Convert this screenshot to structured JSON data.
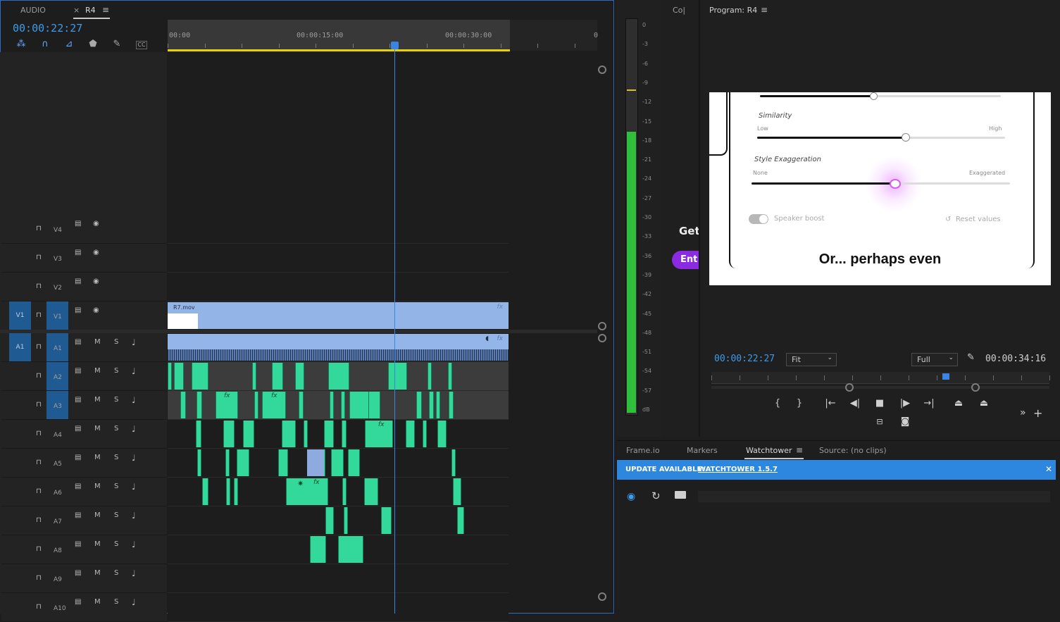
{
  "timeline": {
    "tabs": [
      {
        "label": "AUDIO",
        "active": false
      },
      {
        "label": "×",
        "active": false
      },
      {
        "label": "R4",
        "active": true
      }
    ],
    "menu_icon": "≡",
    "timecode": "00:00:22:27",
    "ruler_labels": [
      "00:00",
      "00:00:15:00",
      "00:00:30:00",
      "0"
    ],
    "tools": [
      "ripple-icon",
      "magnet-icon",
      "linked-select-icon",
      "marker-icon",
      "wrench-icon",
      "captions-icon"
    ],
    "video_tracks": [
      {
        "name": "V4",
        "source_patch": "",
        "target": ""
      },
      {
        "name": "V3",
        "source_patch": "",
        "target": ""
      },
      {
        "name": "V2",
        "source_patch": "",
        "target": ""
      },
      {
        "name": "V1",
        "source_patch": "V1",
        "target": "V1"
      }
    ],
    "audio_tracks": [
      {
        "name": "A1",
        "source_patch": "A1",
        "target": "A1"
      },
      {
        "name": "A2",
        "source_patch": "",
        "target": ""
      },
      {
        "name": "A3",
        "source_patch": "",
        "target": ""
      },
      {
        "name": "A4",
        "source_patch": "",
        "target": ""
      },
      {
        "name": "A5",
        "source_patch": "",
        "target": ""
      },
      {
        "name": "A6",
        "source_patch": "",
        "target": ""
      },
      {
        "name": "A7",
        "source_patch": "",
        "target": ""
      },
      {
        "name": "A8",
        "source_patch": "",
        "target": ""
      },
      {
        "name": "A9",
        "source_patch": "",
        "target": ""
      },
      {
        "name": "A10",
        "source_patch": "",
        "target": ""
      }
    ],
    "mute_label": "M",
    "solo_label": "S",
    "video_clip_name": "R7.mov",
    "fx_label": "fx"
  },
  "meter": {
    "labels": [
      "0",
      "-3",
      "-6",
      "-9",
      "-12",
      "-15",
      "-18",
      "-21",
      "-24",
      "-27",
      "-30",
      "-33",
      "-36",
      "-39",
      "-42",
      "-45",
      "-48",
      "-51",
      "-54",
      "-57",
      "dB"
    ],
    "level_db": -18
  },
  "source": {
    "tab_label": "Co|",
    "partial_text": "Get",
    "partial_button": "Ent"
  },
  "program": {
    "title": "Program: R4",
    "timecode": "00:00:22:27",
    "fit_option": "Fit",
    "resolution_option": "Full",
    "duration": "00:00:34:16",
    "frame": {
      "similarity_label": "Similarity",
      "low_label": "Low",
      "high_label": "High",
      "similarity_value": 0.6,
      "style_label": "Style Exaggeration",
      "none_label": "None",
      "exaggerated_label": "Exaggerated",
      "style_value": 0.55,
      "speaker_boost_label": "Speaker boost",
      "reset_label": "Reset values",
      "caption": "Or... perhaps even"
    },
    "transport_icons": [
      "{",
      "}",
      "|←",
      "◀|",
      "■",
      "|▶",
      "→|",
      "lift-icon",
      "extract-icon"
    ],
    "more_icon": "»",
    "add_icon": "+"
  },
  "bottom": {
    "tabs": [
      {
        "label": "Frame.io",
        "active": false
      },
      {
        "label": "Markers",
        "active": false
      },
      {
        "label": "Watchtower",
        "active": true
      },
      {
        "label": "Source: (no clips)",
        "active": false
      }
    ],
    "menu_icon": "≡",
    "update_prefix": "UPDATE AVAILABLE:",
    "update_link": "WATCHTOWER 1.5.7",
    "close_icon": "✕"
  },
  "colors": {
    "accent": "#3a84e4",
    "clip_green": "#33d99a",
    "clip_blue": "#92b4e6",
    "update_banner": "#2d87df",
    "workarea": "#e7d20a"
  }
}
